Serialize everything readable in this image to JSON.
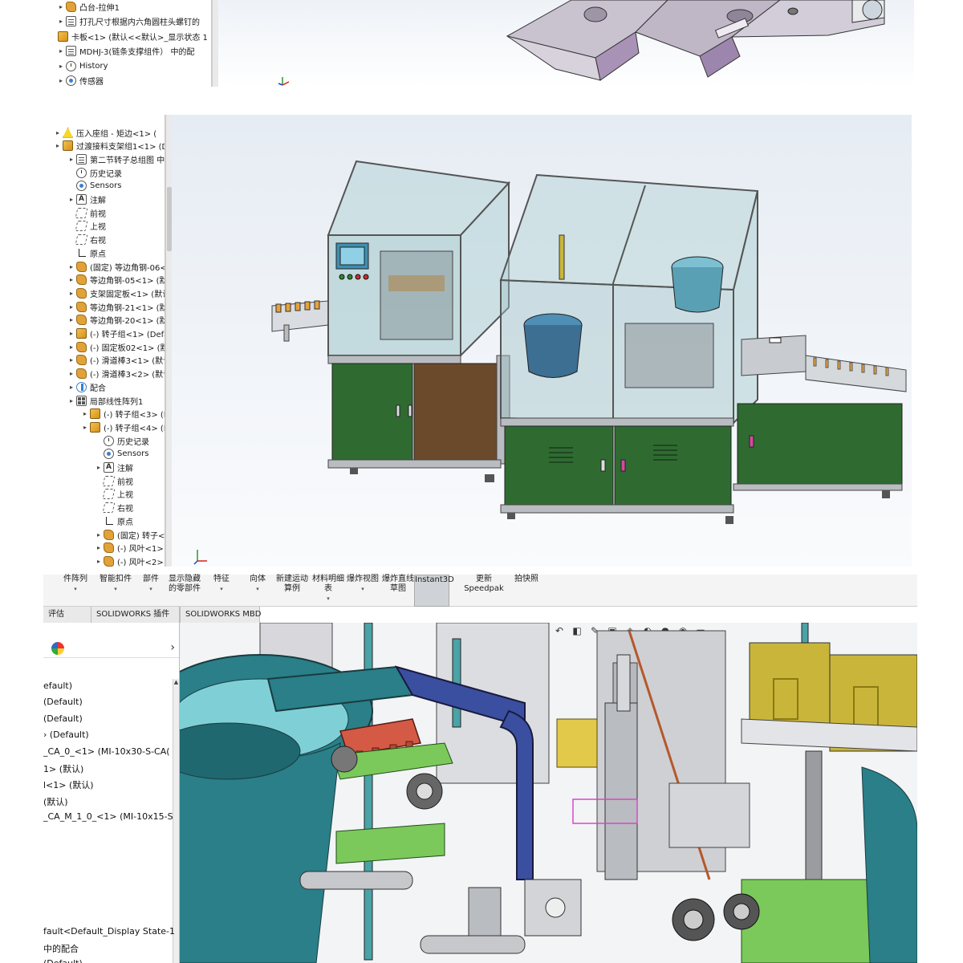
{
  "top_panel": {
    "tree_items": [
      {
        "label": "凸台-拉伸1",
        "icon": "part"
      },
      {
        "label": "打孔尺寸根据内六角圆柱头螺钉的",
        "icon": "doc"
      },
      {
        "label": "卡板<1> (默认<<默认>_显示状态 1",
        "icon": "asm"
      },
      {
        "label": "MDHJ-3(链条支撑组件） 中的配",
        "icon": "doc"
      },
      {
        "label": "History",
        "icon": "clock"
      },
      {
        "label": "传感器",
        "icon": "sensor"
      }
    ]
  },
  "middle_panel": {
    "tree_items": [
      {
        "label": "压入座组 - 矩边<1> (",
        "icon": "warn",
        "indent": 0
      },
      {
        "label": "过渡接料支架组1<1> (Def",
        "icon": "asm",
        "indent": 0
      },
      {
        "label": "第二节转子总组图 中的",
        "icon": "doc",
        "indent": 1
      },
      {
        "label": "历史记录",
        "icon": "clock",
        "indent": 1
      },
      {
        "label": "Sensors",
        "icon": "sensor",
        "indent": 1
      },
      {
        "label": "注解",
        "icon": "anno",
        "indent": 1
      },
      {
        "label": "前视",
        "icon": "plane",
        "indent": 1
      },
      {
        "label": "上视",
        "icon": "plane",
        "indent": 1
      },
      {
        "label": "右视",
        "icon": "plane",
        "indent": 1
      },
      {
        "label": "原点",
        "icon": "origin",
        "indent": 1
      },
      {
        "label": "(固定) 等边角钢-06<1",
        "icon": "part",
        "indent": 1
      },
      {
        "label": "等边角钢-05<1> (默认",
        "icon": "part",
        "indent": 1
      },
      {
        "label": "支架固定板<1> (默认",
        "icon": "part",
        "indent": 1
      },
      {
        "label": "等边角钢-21<1> (默认",
        "icon": "part",
        "indent": 1
      },
      {
        "label": "等边角钢-20<1> (默认",
        "icon": "part",
        "indent": 1
      },
      {
        "label": "(-) 转子组<1> (Defau",
        "icon": "asm",
        "indent": 1
      },
      {
        "label": "(-) 固定板02<1> (默认",
        "icon": "part",
        "indent": 1
      },
      {
        "label": "(-) 滑道棒3<1> (默认",
        "icon": "part",
        "indent": 1
      },
      {
        "label": "(-) 滑道棒3<2> (默认",
        "icon": "part",
        "indent": 1
      },
      {
        "label": "配合",
        "icon": "mate",
        "indent": 1
      },
      {
        "label": "局部线性阵列1",
        "icon": "pattern",
        "indent": 1
      },
      {
        "label": "(-) 转子组<3> (D",
        "icon": "asm",
        "indent": 2
      },
      {
        "label": "(-) 转子组<4> (D",
        "icon": "asm",
        "indent": 2
      },
      {
        "label": "历史记录",
        "icon": "clock",
        "indent": 3
      },
      {
        "label": "Sensors",
        "icon": "sensor",
        "indent": 3
      },
      {
        "label": "注解",
        "icon": "anno",
        "indent": 3
      },
      {
        "label": "前视",
        "icon": "plane",
        "indent": 3
      },
      {
        "label": "上视",
        "icon": "plane",
        "indent": 3
      },
      {
        "label": "右视",
        "icon": "plane",
        "indent": 3
      },
      {
        "label": "原点",
        "icon": "origin",
        "indent": 3
      },
      {
        "label": "(固定) 转子<1",
        "icon": "part",
        "indent": 3
      },
      {
        "label": "(-) 风叶<1> (",
        "icon": "part",
        "indent": 3
      },
      {
        "label": "(-) 风叶<2> (",
        "icon": "part",
        "indent": 3
      }
    ]
  },
  "bottom_panel": {
    "ribbon": [
      {
        "label": "件阵列",
        "dropdown": true
      },
      {
        "label": "智能扣件",
        "dropdown": true
      },
      {
        "label": "部件",
        "dropdown": true
      },
      {
        "label": "显示隐藏的零部件",
        "dropdown": false
      },
      {
        "label": "特征",
        "dropdown": true
      },
      {
        "label": "向体",
        "dropdown": true
      },
      {
        "label": "新建运动算例",
        "dropdown": false
      },
      {
        "label": "材料明细表",
        "dropdown": true
      },
      {
        "label": "爆炸视图",
        "dropdown": true
      },
      {
        "label": "爆炸直线草图",
        "dropdown": false
      },
      {
        "label": "Instant3D",
        "dropdown": false
      },
      {
        "label": "更新Speedpak",
        "dropdown": false
      },
      {
        "label": "拍快照",
        "dropdown": false
      }
    ],
    "tabs": [
      "评估",
      "SOLIDWORKS 插件",
      "SOLIDWORKS MBD"
    ],
    "tree_lines": [
      "efault)",
      "(Default)",
      "(Default)",
      "› (Default)",
      "_CA_0_<1> (MI-10x30-S-CA(",
      "1> (默认)",
      "l<1> (默认)",
      "(默认)",
      "_CA_M_1_0_<1> (MI-10x15-S"
    ],
    "tree_bottom_lines": [
      "fault<Default_Display State-1",
      "中的配合",
      "(Default)"
    ]
  },
  "colors": {
    "machine_green": "#2f6b31",
    "frame_gray": "#b9bcc0",
    "glass": "#9fc4c8",
    "bowl_teal": "#2a7f88",
    "door_brown": "#6b4a2b",
    "accent_yellow": "#c9b53a"
  }
}
